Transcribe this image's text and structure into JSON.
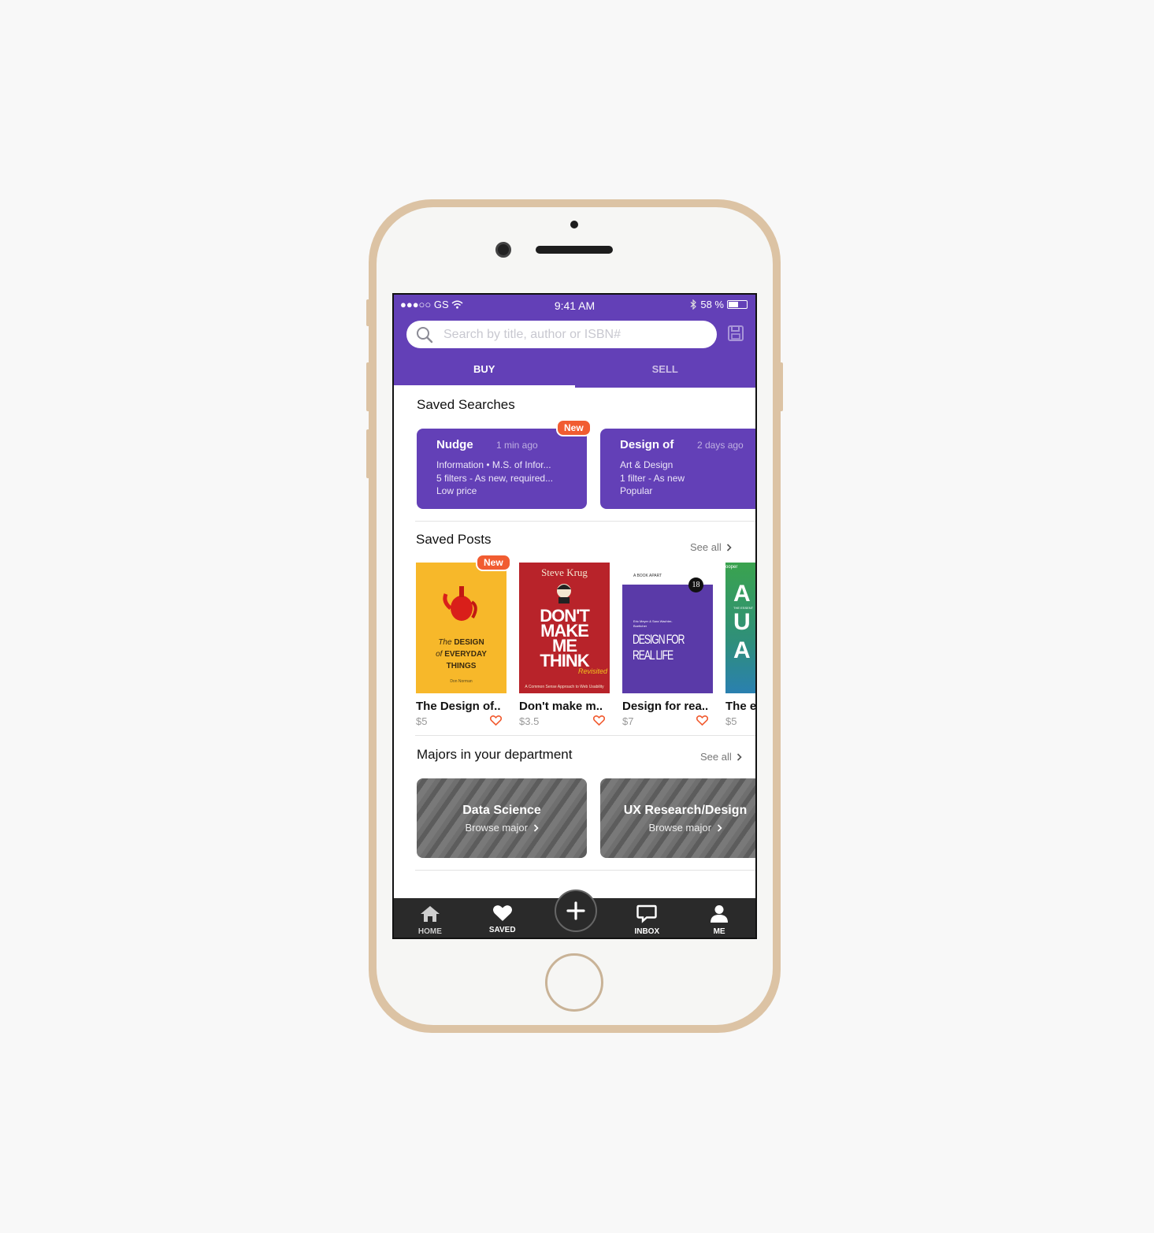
{
  "status": {
    "carrier": "●●●○○ GS",
    "time": "9:41 AM",
    "battery": "58 %"
  },
  "search": {
    "placeholder": "Search by title, author or ISBN#"
  },
  "tabs": [
    {
      "label": "BUY",
      "active": true
    },
    {
      "label": "SELL",
      "active": false
    }
  ],
  "saved_searches": {
    "title": "Saved Searches",
    "items": [
      {
        "title": "Nudge",
        "ago": "1 min ago",
        "badge": "New",
        "lines": [
          "Information • M.S. of Infor...",
          "5 filters - As new, required...",
          "Low price"
        ]
      },
      {
        "title": "Design of",
        "ago": "2 days ago",
        "lines": [
          "Art & Design",
          "1 filter - As new",
          "Popular"
        ]
      }
    ]
  },
  "saved_posts": {
    "title": "Saved Posts",
    "see_all": "See all",
    "items": [
      {
        "title": "The Design of..",
        "price": "$5",
        "badge": "New",
        "cover_color": "#f7b82a"
      },
      {
        "title": "Don't make m..",
        "price": "$3.5",
        "cover_color": "#b8232a"
      },
      {
        "title": "Design for rea..",
        "price": "$7",
        "cover_color": "#5a3aa8"
      },
      {
        "title": "The e",
        "price": "$5",
        "cover_color": "#2e9b5a"
      }
    ],
    "covers": {
      "book1": {
        "line1a": "The",
        "line1b": "DESIGN",
        "line2a": "of",
        "line2b": "EVERYDAY",
        "line3": "THINGS",
        "author": "Don Norman"
      },
      "book2": {
        "author": "Steve Krug",
        "t1": "DON'T",
        "t2": "MAKE",
        "t3": "ME",
        "t4": "THINK",
        "rev": "Revisited",
        "sub": "A Common Sense Approach to Web Usability"
      },
      "book3": {
        "series": "A BOOK APART",
        "authors": "Eric Meyer & Sara Wachter-Boettcher",
        "t1": "DESIGN FOR",
        "t2": "REAL LIFE",
        "num": "18"
      },
      "book4": {
        "top": "ooper",
        "l1": "A",
        "l2": "U",
        "l3": "A",
        "sub": "THE ESSENT"
      }
    }
  },
  "majors": {
    "title": "Majors in your department",
    "see_all": "See all",
    "items": [
      {
        "name": "Data Science",
        "action": "Browse major"
      },
      {
        "name": "UX Research/Design",
        "action": "Browse major"
      }
    ]
  },
  "nav": {
    "home": "HOME",
    "saved": "SAVED",
    "inbox": "INBOX",
    "me": "ME"
  },
  "colors": {
    "primary": "#6340b7",
    "accent": "#f15c31",
    "nav_bg": "#2a2a2a"
  }
}
